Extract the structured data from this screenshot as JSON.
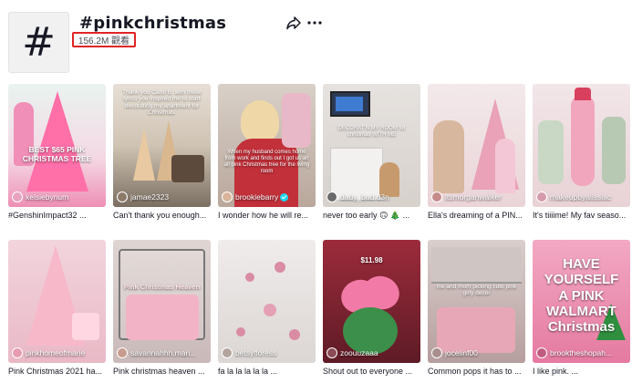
{
  "header": {
    "icon_glyph": "#",
    "title": "#pinkchristmas",
    "views": "156.2M 觀看"
  },
  "accent": {
    "highlight_border": "#e02424",
    "verified": "#20d5ec"
  },
  "videos": [
    {
      "author": "kelsiebynum",
      "caption": "#GenshinImpact32 ...",
      "overlay": "BEST $65 PINK CHRISTMAS TREE",
      "verified": false
    },
    {
      "author": "jamae2323",
      "caption": "Can't thank you enough...",
      "overlay": "Thank you Carol B. with these lyrics you inspired me to start decorating my apartment for Christmas.",
      "verified": false
    },
    {
      "author": "brookiebarry",
      "caption": "I wonder how he will re...",
      "overlay": "When my husband comes home from work and finds out I got us an all pink Christmas tree for the living room",
      "verified": true
    },
    {
      "author": "dady_bad.d3n",
      "caption": "never too early 🙃 🎄 ...",
      "overlay": "DECORAT'N MY ROOM for christmas WITH ME",
      "verified": false
    },
    {
      "author": "itsmorganwalker",
      "caption": "Ella's dreaming of a PIN...",
      "overlay": "",
      "verified": false
    },
    {
      "author": "makeupbyalissiac",
      "caption": "It's tiiiime! My fav seaso...",
      "overlay": "",
      "verified": false
    },
    {
      "author": "pinkhomeofmarie",
      "caption": "Pink Christmas 2021 ha...",
      "overlay": "",
      "verified": false
    },
    {
      "author": "savannahhh.mari...",
      "caption": "Pink christmas heaven ...",
      "overlay": "Pink Christmas Heaven",
      "verified": false
    },
    {
      "author": "betsyfloress",
      "caption": "fa la la la la la ...",
      "overlay": "",
      "verified": false
    },
    {
      "author": "zoouuzaaa",
      "caption": "Shout out to everyone ...",
      "overlay": "$11.98",
      "verified": false
    },
    {
      "author": "jocelinf00",
      "caption": "Common pops it has to ...",
      "overlay": "me and mom picking cute pink girly decor",
      "verified": false
    },
    {
      "author": "brooktheshopah...",
      "caption": "I like pink. ...",
      "overlay": "HAVE YOURSELF A PINK WALMART Christmas",
      "verified": false
    }
  ]
}
